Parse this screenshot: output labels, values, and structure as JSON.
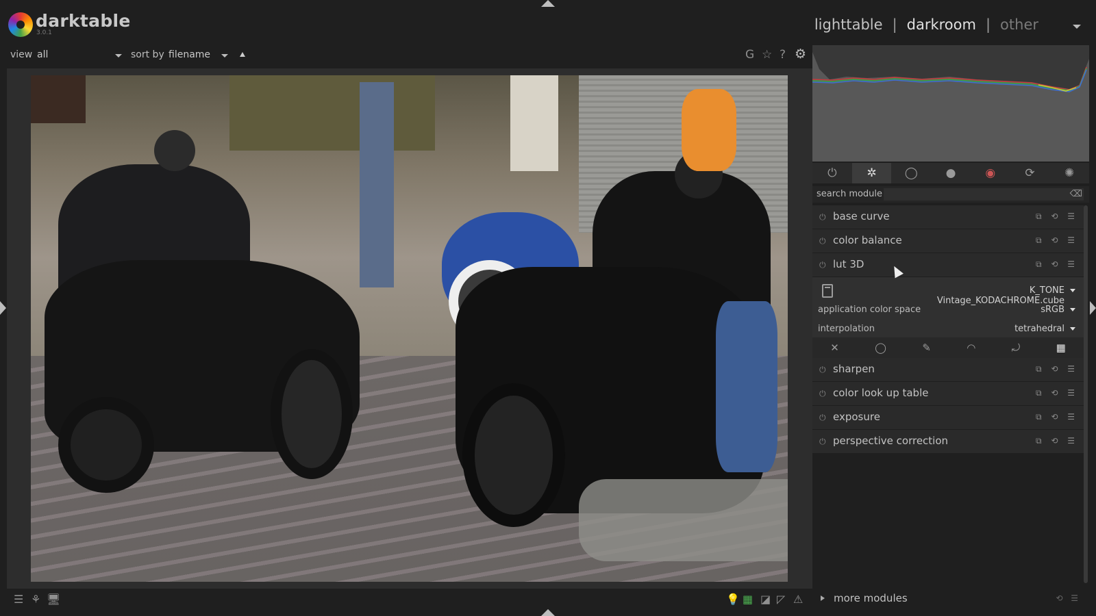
{
  "app": {
    "name": "darktable",
    "version": "3.0.1"
  },
  "views": {
    "lighttable": "lighttable",
    "darkroom": "darkroom",
    "other": "other",
    "separator": "|"
  },
  "filter": {
    "view_label": "view",
    "view_value": "all",
    "sort_label": "sort by",
    "sort_value": "filename"
  },
  "top_tools": {
    "grouping": "G",
    "star": "☆",
    "help": "?",
    "settings": "⚙"
  },
  "module_groups": [
    "⏻",
    "✲",
    "◯",
    "●",
    "◉",
    "⟳",
    "✺"
  ],
  "search": {
    "label": "search module",
    "placeholder": "",
    "clear": "⌫"
  },
  "modules": {
    "base_curve": "base curve",
    "color_balance": "color balance",
    "lut_3d": "lut 3D",
    "sharpen": "sharpen",
    "color_lookup_table": "color look up table",
    "exposure": "exposure",
    "perspective_correction": "perspective correction"
  },
  "module_actions": "⧉ ⟲ ☰",
  "lut": {
    "file": "K_TONE Vintage_KODACHROME.cube",
    "color_space_label": "application color space",
    "color_space_value": "sRGB",
    "interpolation_label": "interpolation",
    "interpolation_value": "tetrahedral"
  },
  "mask_icons": [
    "✕",
    "◯",
    "✎",
    "◠",
    "⤾",
    "▦"
  ],
  "more_modules": {
    "label": "more modules",
    "actions": "⟲ ☰"
  },
  "bottom_left_icons": [
    "☰",
    "⚘",
    "🖥"
  ],
  "bottom_right_icons": [
    "💡",
    "▦",
    "◪",
    "◸",
    "⚠"
  ]
}
